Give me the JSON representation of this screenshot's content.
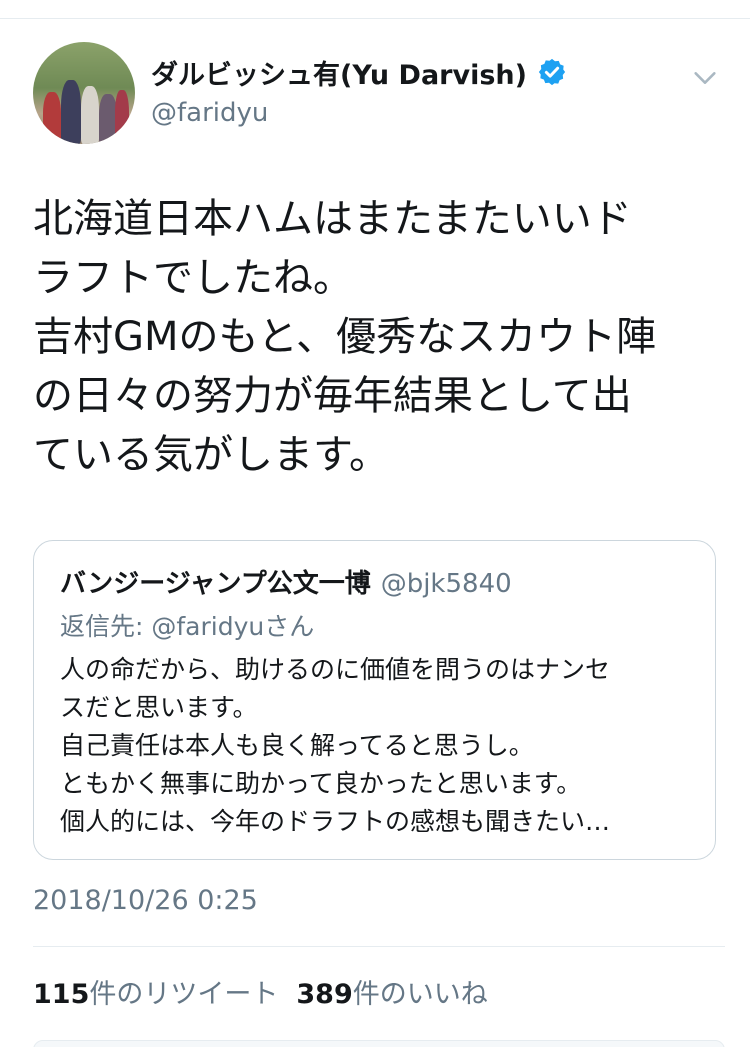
{
  "tweet": {
    "author": {
      "display_name": "ダルビッシュ有(Yu Darvish)",
      "handle": "@faridyu",
      "verified": true,
      "verified_icon": "verified-badge-icon"
    },
    "menu_icon": "chevron-down-icon",
    "text": "北海道日本ハムはまたまたいいド\nラフトでしたね。\n吉村GMのもと、優秀なスカウト陣\nの日々の努力が毎年結果として出\nている気がします。",
    "quoted": {
      "display_name": "バンジージャンプ公文一博",
      "handle": "@bjk5840",
      "reply_to": "返信先: @faridyuさん",
      "text": "人の命だから、助けるのに価値を問うのはナンセ\nスだと思います。\n自己責任は本人も良く解ってると思うし。\nともかく無事に助かって良かったと思います。\n個人的には、今年のドラフトの感想も聞きたい…"
    },
    "timestamp": "2018/10/26 0:25",
    "stats": {
      "retweets_count": "115",
      "retweets_label": "件のリツイート",
      "likes_count": "389",
      "likes_label": "件のいいね"
    }
  },
  "colors": {
    "text_primary": "#14171a",
    "text_secondary": "#657786",
    "verified_blue": "#1da1f2",
    "divider": "#e6ecf0",
    "border": "#ccd6dd"
  }
}
